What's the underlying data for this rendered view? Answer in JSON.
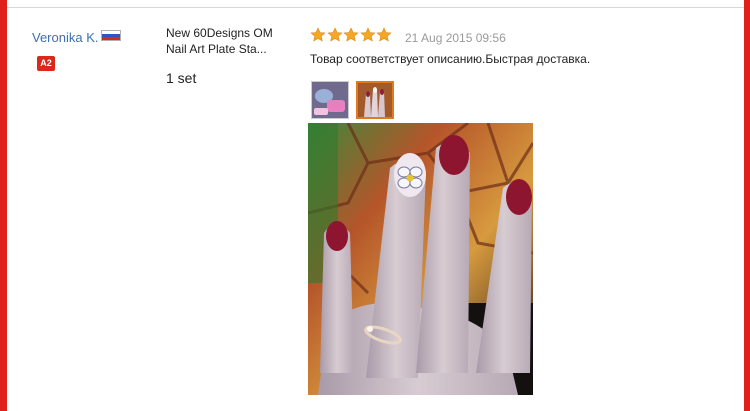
{
  "buyer": {
    "name": "Veronika K.",
    "country": "Russia",
    "level": "A2"
  },
  "product": {
    "title": "New 60Designs OM Nail Art Plate Sta...",
    "quantity": "1 set"
  },
  "review": {
    "rating": 5,
    "max_rating": 5,
    "date": "21 Aug 2015 09:56",
    "text": "Товар соответствует описанию.Быстрая доставка."
  },
  "photos": [
    {
      "icon": "photo-thumbnail-1",
      "selected": false
    },
    {
      "icon": "photo-thumbnail-2",
      "selected": true
    }
  ],
  "colors": {
    "frame": "#e0201c",
    "link": "#3b6fb6",
    "star": "#f5a623",
    "badge": "#d9291c",
    "selected_thumb": "#e07a1c"
  }
}
